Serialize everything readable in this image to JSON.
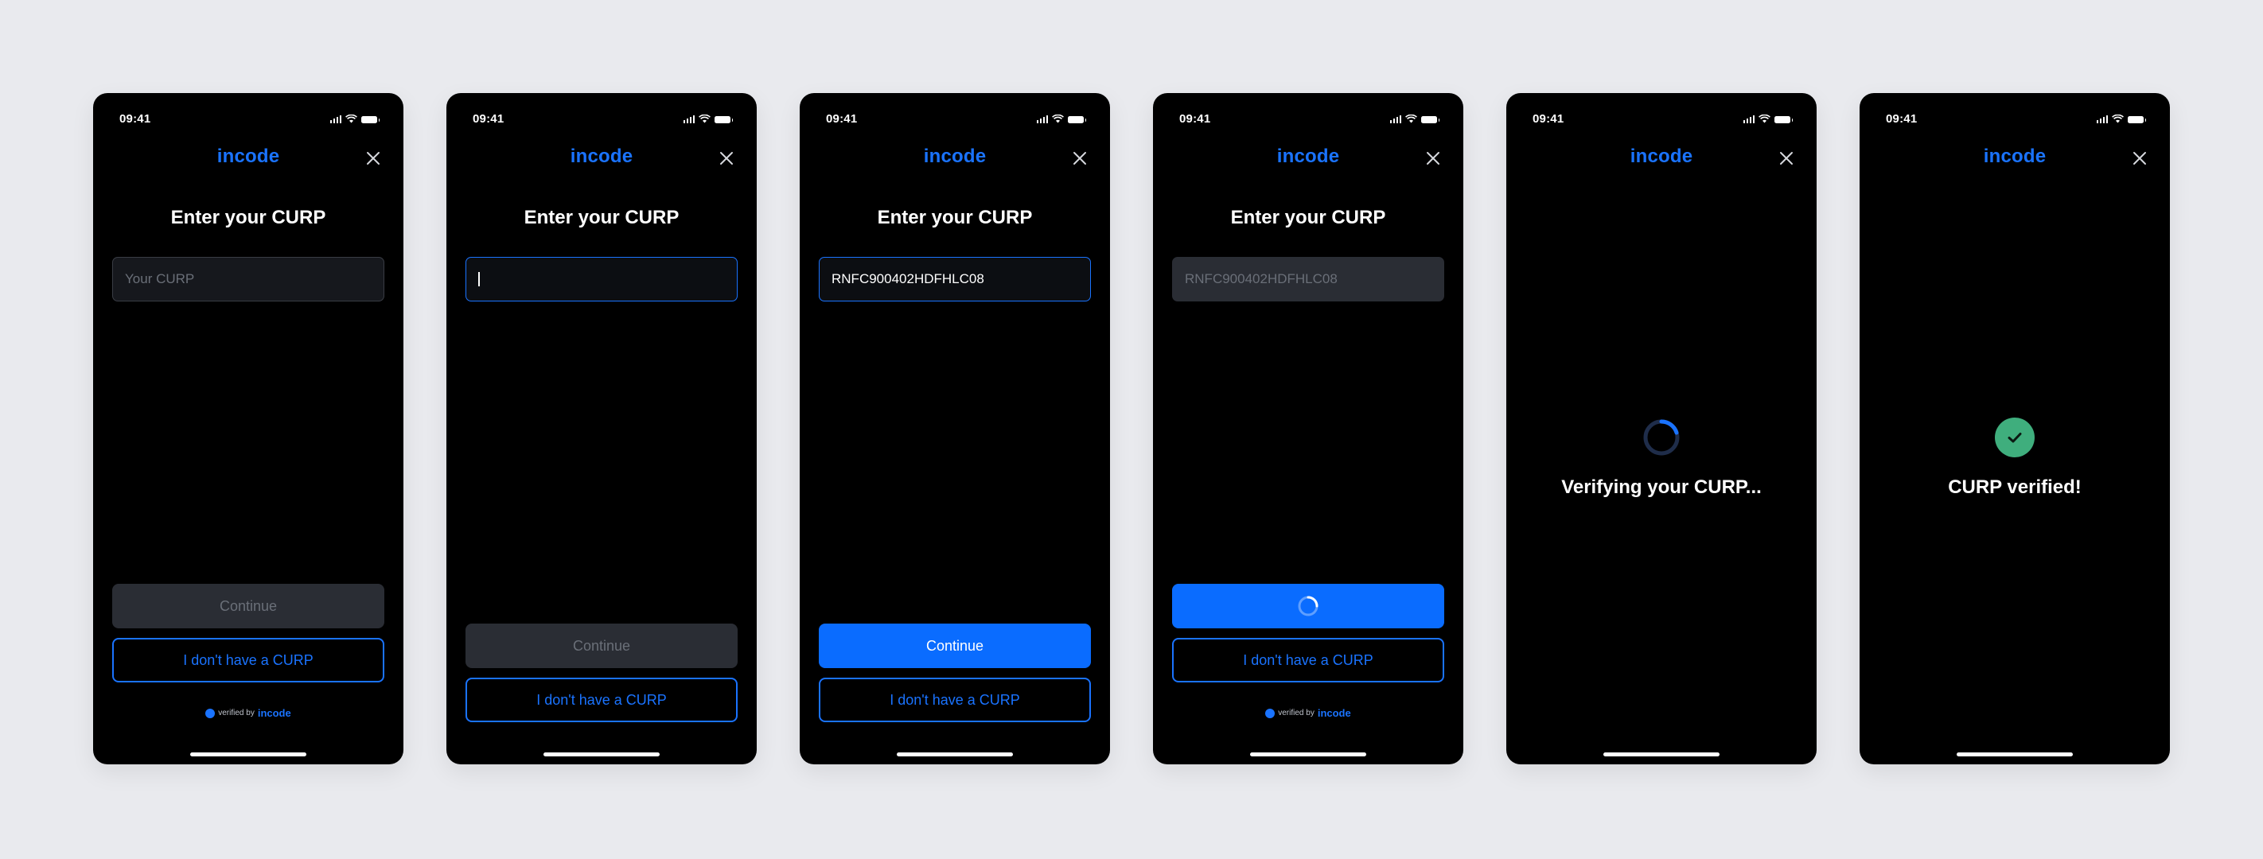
{
  "screens": [
    {
      "time": "09:41",
      "logo": "incode",
      "title": "Enter your CURP",
      "input": {
        "placeholder": "Your CURP",
        "value": ""
      },
      "continue_label": "Continue",
      "no_curp_label": "I don't have a CURP",
      "verified_by": "verified by",
      "verified_brand": "incode"
    },
    {
      "time": "09:41",
      "logo": "incode",
      "title": "Enter your CURP",
      "input": {
        "value": ""
      },
      "continue_label": "Continue",
      "no_curp_label": "I don't have a CURP"
    },
    {
      "time": "09:41",
      "logo": "incode",
      "title": "Enter your CURP",
      "input": {
        "value": "RNFC900402HDFHLC08"
      },
      "continue_label": "Continue",
      "no_curp_label": "I don't have a CURP"
    },
    {
      "time": "09:41",
      "logo": "incode",
      "title": "Enter your CURP",
      "input": {
        "value": "RNFC900402HDFHLC08"
      },
      "no_curp_label": "I don't have a CURP",
      "verified_by": "verified by",
      "verified_brand": "incode"
    },
    {
      "time": "09:41",
      "logo": "incode",
      "message": "Verifying your CURP..."
    },
    {
      "time": "09:41",
      "logo": "incode",
      "message": "CURP verified!"
    }
  ],
  "colors": {
    "background": "#e9eaee",
    "phone": "#000000",
    "accent_blue": "#0a6cff",
    "disabled_button": "#2a2d34",
    "success_green": "#3fae7d"
  },
  "icons": [
    "cellular-signal-icon",
    "wifi-icon",
    "battery-icon",
    "close-icon",
    "spinner-icon",
    "checkmark-icon",
    "incode-dot-icon"
  ]
}
